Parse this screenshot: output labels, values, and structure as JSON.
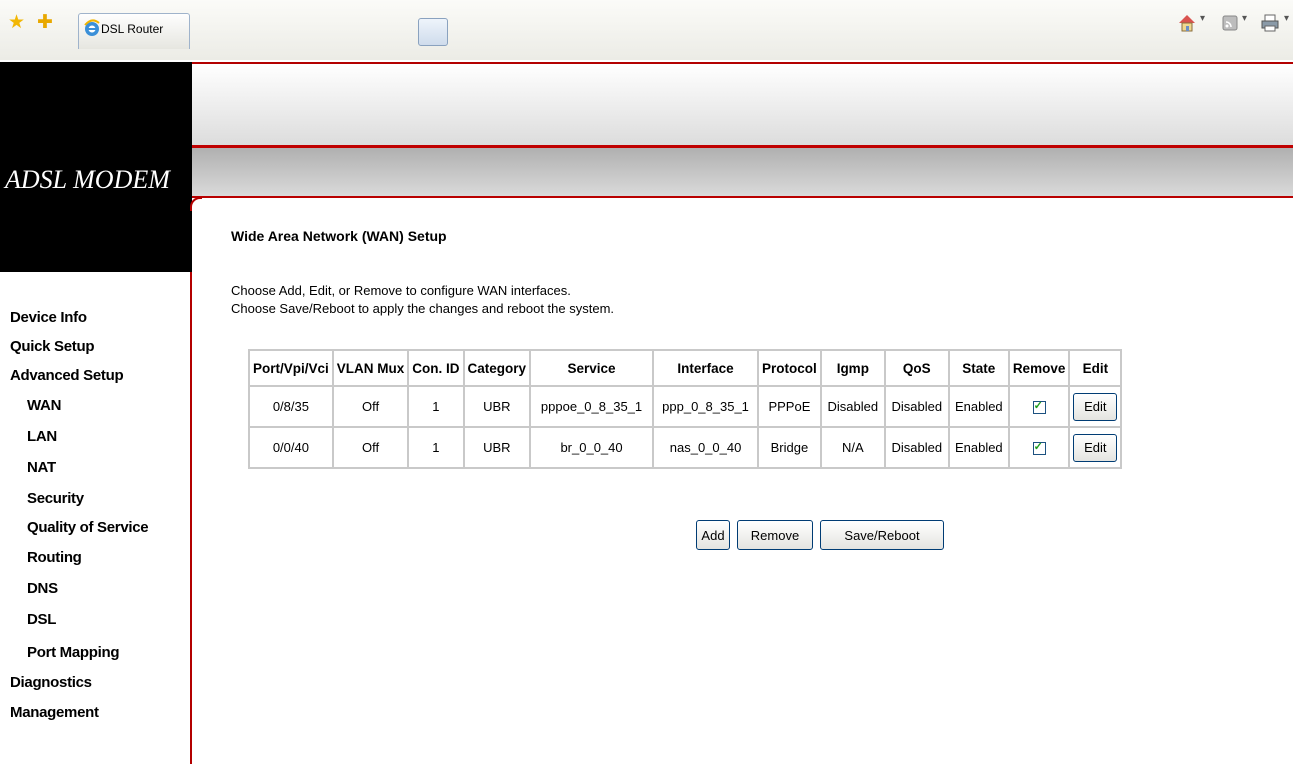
{
  "browser": {
    "tab_title": "DSL Router"
  },
  "banner": {
    "logo": "ADSL MODEM"
  },
  "sidebar": {
    "items": [
      {
        "label": "Device Info"
      },
      {
        "label": "Quick Setup"
      },
      {
        "label": "Advanced Setup"
      },
      {
        "label": "WAN"
      },
      {
        "label": "LAN"
      },
      {
        "label": "NAT"
      },
      {
        "label": "Security"
      },
      {
        "label": "Quality of Service"
      },
      {
        "label": "Routing"
      },
      {
        "label": "DNS"
      },
      {
        "label": "DSL"
      },
      {
        "label": "Port Mapping"
      },
      {
        "label": "Diagnostics"
      },
      {
        "label": "Management"
      }
    ]
  },
  "main": {
    "title": "Wide Area Network (WAN) Setup",
    "desc1": "Choose Add, Edit, or Remove to configure WAN interfaces.",
    "desc2": "Choose Save/Reboot to apply the changes and reboot the system.",
    "table": {
      "headers": [
        "Port/Vpi/Vci",
        "VLAN Mux",
        "Con. ID",
        "Category",
        "Service",
        "Interface",
        "Protocol",
        "Igmp",
        "QoS",
        "State",
        "Remove",
        "Edit"
      ],
      "rows": [
        [
          "0/8/35",
          "Off",
          "1",
          "UBR",
          "pppoe_0_8_35_1",
          "ppp_0_8_35_1",
          "PPPoE",
          "Disabled",
          "Disabled",
          "Enabled"
        ],
        [
          "0/0/40",
          "Off",
          "1",
          "UBR",
          "br_0_0_40",
          "nas_0_0_40",
          "Bridge",
          "N/A",
          "Disabled",
          "Enabled"
        ]
      ],
      "remove_checked": [
        true,
        true
      ],
      "edit_label": "Edit"
    },
    "buttons": {
      "add": "Add",
      "remove": "Remove",
      "save_reboot": "Save/Reboot"
    }
  },
  "colors": {
    "accent_red": "#b30000",
    "logo_bg": "#000000"
  }
}
